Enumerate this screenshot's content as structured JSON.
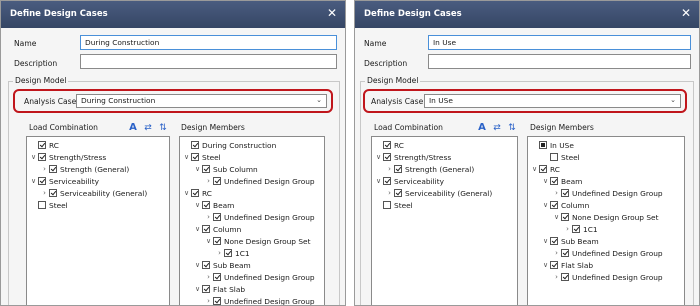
{
  "left": {
    "title": "Define Design Cases",
    "name_label": "Name",
    "name_value": "During Construction",
    "description_label": "Description",
    "description_value": "",
    "design_model_label": "Design Model",
    "analysis_case_label": "Analysis Case",
    "analysis_case_value": "During Construction",
    "load_combination_label": "Load Combination",
    "design_members_label": "Design Members",
    "load_tree": [
      "RC",
      "Strength/Stress",
      "Strength (General)",
      "Serviceability",
      "Serviceability (General)",
      "Steel"
    ],
    "member_tree": [
      "During Construction",
      "Steel",
      "Sub Column",
      "Undefined Design Group",
      "RC",
      "Beam",
      "Undefined Design Group",
      "Column",
      "None Design Group Set",
      "1C1",
      "Sub Beam",
      "Undefined Design Group",
      "Flat Slab",
      "Undefined Design Group"
    ]
  },
  "right": {
    "title": "Define Design Cases",
    "name_label": "Name",
    "name_value": "In Use",
    "description_label": "Description",
    "description_value": "",
    "design_model_label": "Design Model",
    "analysis_case_label": "Analysis Case",
    "analysis_case_value": "In USe",
    "load_combination_label": "Load Combination",
    "design_members_label": "Design Members",
    "load_tree": [
      "RC",
      "Strength/Stress",
      "Strength (General)",
      "Serviceability",
      "Serviceability (General)",
      "Steel"
    ],
    "member_tree": [
      "In USe",
      "Steel",
      "RC",
      "Beam",
      "Undefined Design Group",
      "Column",
      "None Design Group Set",
      "1C1",
      "Sub Beam",
      "Undefined Design Group",
      "Flat Slab",
      "Undefined Design Group"
    ]
  },
  "icons": {
    "close": "close-icon",
    "font": "font-icon",
    "swap": "swap-icon",
    "sort": "sort-icon",
    "dropdown": "chevron-down-icon"
  },
  "colors": {
    "titlebar": "#3d4f73",
    "highlight": "#c0161c",
    "accent": "#2b62c8"
  }
}
